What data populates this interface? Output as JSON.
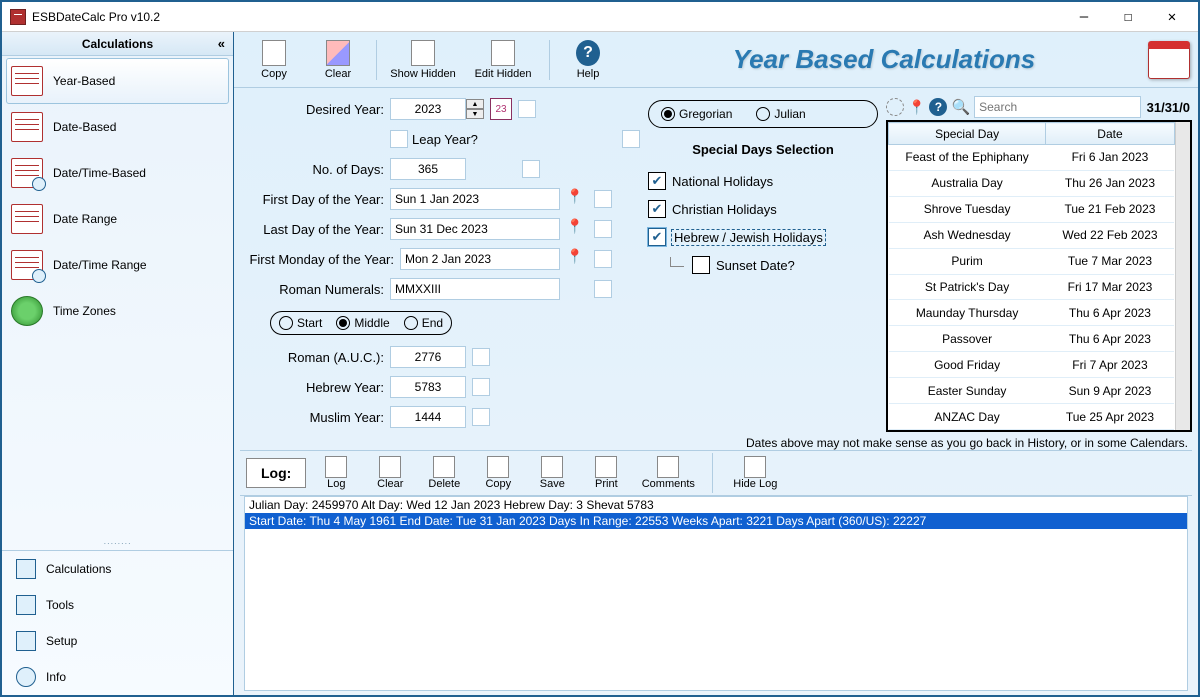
{
  "window": {
    "title": "ESBDateCalc Pro v10.2"
  },
  "sidebar": {
    "header": "Calculations",
    "items": [
      {
        "label": "Year-Based",
        "icon": "calendar-icon",
        "selected": true
      },
      {
        "label": "Date-Based",
        "icon": "calendar-icon"
      },
      {
        "label": "Date/Time-Based",
        "icon": "calendar-clock-icon"
      },
      {
        "label": "Date Range",
        "icon": "calendar-icon"
      },
      {
        "label": "Date/Time Range",
        "icon": "calendar-clock-icon"
      },
      {
        "label": "Time Zones",
        "icon": "globe-icon"
      }
    ],
    "bottom": [
      {
        "label": "Calculations",
        "icon": "calculator-icon"
      },
      {
        "label": "Tools",
        "icon": "wrench-icon"
      },
      {
        "label": "Setup",
        "icon": "sliders-icon"
      },
      {
        "label": "Info",
        "icon": "info-icon"
      }
    ]
  },
  "toolbar": {
    "copy": "Copy",
    "clear": "Clear",
    "show_hidden": "Show Hidden",
    "edit_hidden": "Edit Hidden",
    "help": "Help"
  },
  "page_title": "Year Based Calculations",
  "form": {
    "desired_year_label": "Desired Year:",
    "desired_year_value": "2023",
    "desired_year_short": "23",
    "leap_year_label": "Leap Year?",
    "no_of_days_label": "No. of Days:",
    "no_of_days_value": "365",
    "first_day_label": "First Day of the Year:",
    "first_day_value": "Sun 1 Jan 2023",
    "last_day_label": "Last Day of the Year:",
    "last_day_value": "Sun 31 Dec 2023",
    "first_monday_label": "First Monday of the Year:",
    "first_monday_value": "Mon 2 Jan 2023",
    "roman_numerals_label": "Roman Numerals:",
    "roman_numerals_value": "MMXXIII",
    "position_start": "Start",
    "position_middle": "Middle",
    "position_end": "End",
    "roman_auc_label": "Roman (A.U.C.):",
    "roman_auc_value": "2776",
    "hebrew_year_label": "Hebrew Year:",
    "hebrew_year_value": "5783",
    "muslim_year_label": "Muslim Year:",
    "muslim_year_value": "1444"
  },
  "cal_type": {
    "gregorian": "Gregorian",
    "julian": "Julian"
  },
  "special": {
    "title": "Special Days Selection",
    "national": "National Holidays",
    "christian": "Christian Holidays",
    "hebrew": "Hebrew / Jewish Holidays",
    "sunset": "Sunset Date?"
  },
  "search": {
    "placeholder": "Search",
    "count": "31/31/0"
  },
  "grid": {
    "headers": {
      "day": "Special Day",
      "date": "Date"
    },
    "rows": [
      {
        "day": "Feast of the Ephiphany",
        "date": "Fri 6 Jan 2023"
      },
      {
        "day": "Australia Day",
        "date": "Thu 26 Jan 2023"
      },
      {
        "day": "Shrove Tuesday",
        "date": "Tue 21 Feb 2023"
      },
      {
        "day": "Ash Wednesday",
        "date": "Wed 22 Feb 2023"
      },
      {
        "day": "Purim",
        "date": "Tue 7 Mar 2023"
      },
      {
        "day": "St Patrick's Day",
        "date": "Fri 17 Mar 2023"
      },
      {
        "day": "Maunday Thursday",
        "date": "Thu 6 Apr 2023"
      },
      {
        "day": "Passover",
        "date": "Thu 6 Apr 2023"
      },
      {
        "day": "Good Friday",
        "date": "Fri 7 Apr 2023"
      },
      {
        "day": "Easter Sunday",
        "date": "Sun 9 Apr 2023"
      },
      {
        "day": "ANZAC Day",
        "date": "Tue 25 Apr 2023"
      }
    ]
  },
  "note": "Dates above may not make sense as you go back in History, or in some Calendars.",
  "log_toolbar": {
    "log_label": "Log:",
    "log": "Log",
    "clear": "Clear",
    "delete": "Delete",
    "copy": "Copy",
    "save": "Save",
    "print": "Print",
    "comments": "Comments",
    "hide": "Hide Log"
  },
  "log_lines": [
    "Julian Day: 2459970 Alt Day: Wed 12 Jan 2023 Hebrew Day: 3 Shevat 5783",
    "Start Date: Thu 4 May 1961 End Date: Tue 31 Jan 2023 Days In Range: 22553 Weeks Apart: 3221 Days Apart (360/US): 22227"
  ]
}
